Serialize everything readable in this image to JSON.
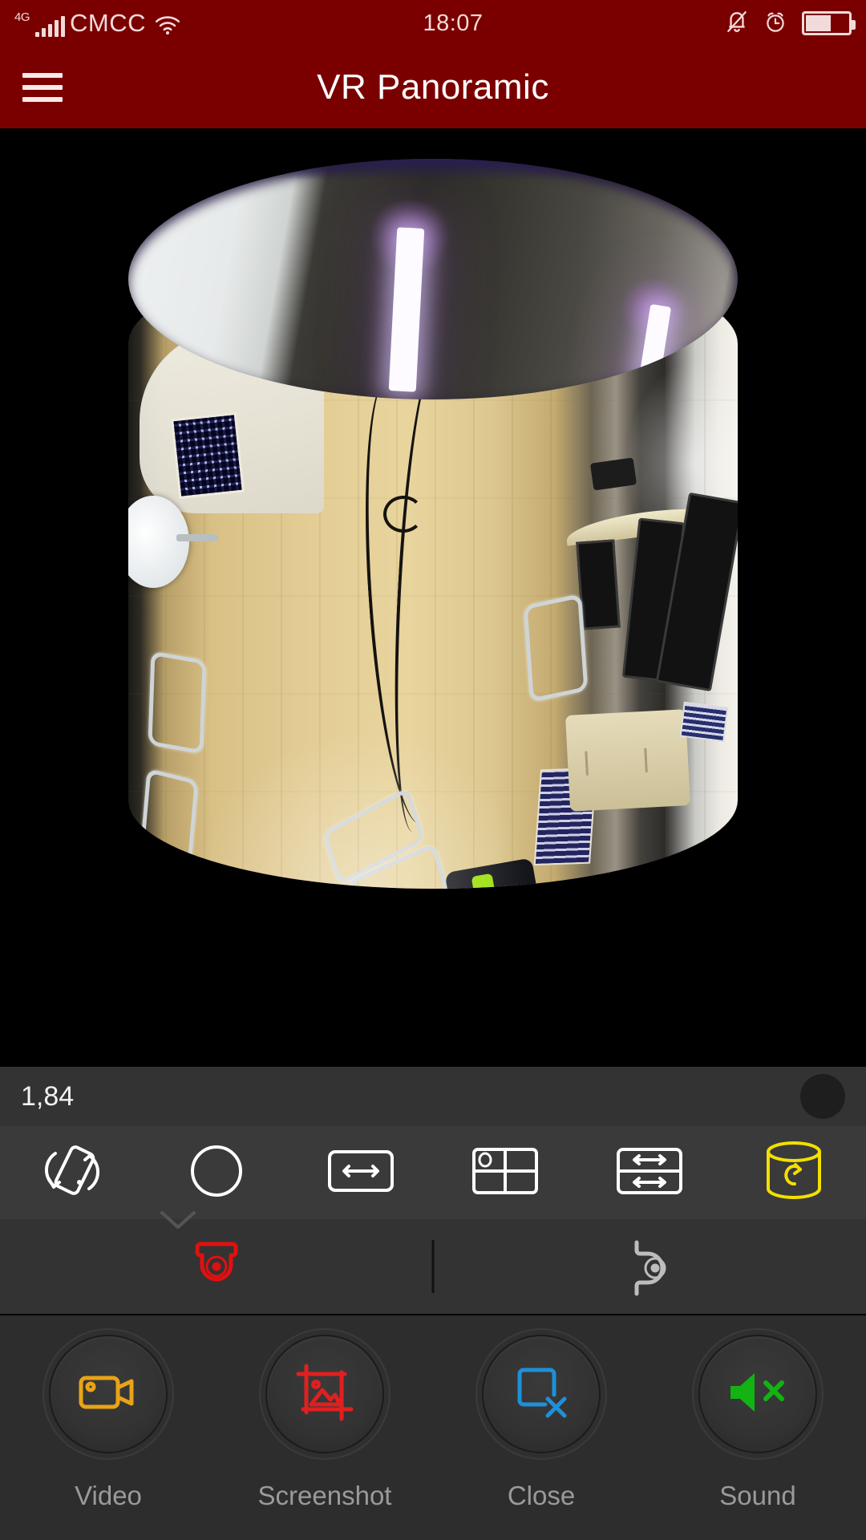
{
  "status_bar": {
    "network_type": "4G",
    "carrier": "CMCC",
    "wifi_icon": "wifi-icon",
    "time": "18:07",
    "silent_icon": "bell-slash-icon",
    "alarm_icon": "alarm-clock-icon",
    "battery_icon": "battery-icon",
    "battery_level_percent": 55
  },
  "header": {
    "menu_icon": "hamburger-menu-icon",
    "title": "VR Panoramic",
    "background_color": "#7a0000",
    "title_color": "#ffffff"
  },
  "video": {
    "projection": "cylinder",
    "background_color": "#000000",
    "description": "Live 360 fisheye camera feed unwrapped as a VR cylinder view of a room interior"
  },
  "bitrate_bar": {
    "value": "1,84",
    "record_indicator_icon": "record-dot-icon",
    "background_color": "#333333"
  },
  "view_modes": [
    {
      "name": "screen-rotate-icon",
      "label": "Screen Rotation",
      "active": false,
      "color": "#ffffff"
    },
    {
      "name": "fisheye-circle-icon",
      "label": "Fisheye",
      "active": false,
      "color": "#ffffff"
    },
    {
      "name": "panorama-single-icon",
      "label": "Panorama 360",
      "active": false,
      "color": "#ffffff"
    },
    {
      "name": "quad-split-icon",
      "label": "Quad Split",
      "active": false,
      "color": "#ffffff"
    },
    {
      "name": "panorama-dual-icon",
      "label": "Dual Panorama",
      "active": false,
      "color": "#ffffff"
    },
    {
      "name": "vr-cylinder-icon",
      "label": "VR Cylinder",
      "active": true,
      "color": "#f2e000"
    }
  ],
  "camera_mounts": [
    {
      "name": "ceiling-mount-dome-icon",
      "label": "Ceiling Mount",
      "active": true,
      "color": "#e01010"
    },
    {
      "name": "wall-mount-dome-icon",
      "label": "Wall Mount",
      "active": false,
      "color": "#bdbdbd"
    }
  ],
  "actions": [
    {
      "icon": "video-camera-icon",
      "label": "Video",
      "color": "#e8a317"
    },
    {
      "icon": "screenshot-icon",
      "label": "Screenshot",
      "color": "#e02020"
    },
    {
      "icon": "close-window-icon",
      "label": "Close",
      "color": "#1e90d8"
    },
    {
      "icon": "sound-muted-icon",
      "label": "Sound",
      "color": "#12b312"
    }
  ]
}
